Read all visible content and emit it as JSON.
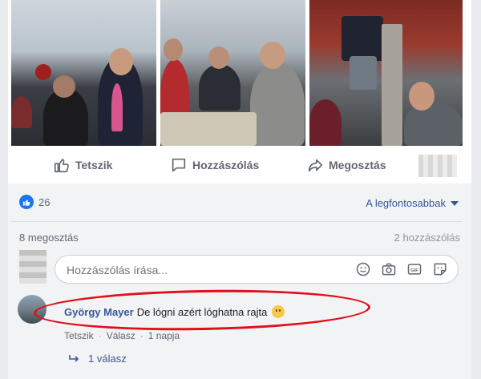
{
  "post": {
    "actions": {
      "like_label": "Tetszik",
      "comment_label": "Hozzászólás",
      "share_label": "Megosztás"
    },
    "reactions": {
      "count": "26"
    },
    "sort_label": "A legfontosabbak",
    "shares_label": "8 megosztás",
    "comments_count_label": "2 hozzászólás"
  },
  "composer": {
    "placeholder": "Hozzászólás írása...",
    "icons": [
      "emoji-icon",
      "camera-icon",
      "gif-icon",
      "sticker-icon"
    ]
  },
  "comment": {
    "author": "György Mayer",
    "text": "De lógni azért lóghatna rajta",
    "like_label": "Tetszik",
    "reply_label": "Válasz",
    "time_label": "1 napja",
    "replies_label": "1 válasz"
  },
  "colors": {
    "accent": "#385898",
    "like_blue": "#1877f2",
    "highlight_red": "#e0101a"
  }
}
